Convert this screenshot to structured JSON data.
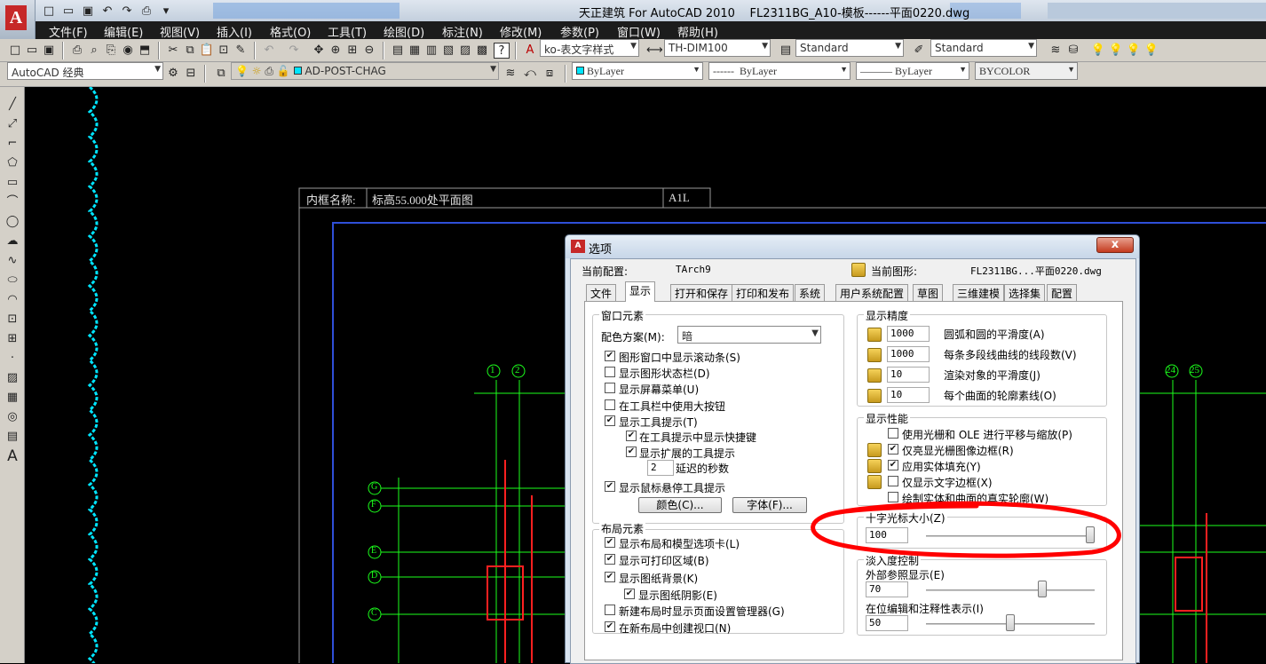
{
  "window": {
    "app_title": "天正建筑 For AutoCAD 2010",
    "file_title": "FL2311BG_A10-模板------平面0220.dwg"
  },
  "menu": [
    "文件(F)",
    "编辑(E)",
    "视图(V)",
    "插入(I)",
    "格式(O)",
    "工具(T)",
    "绘图(D)",
    "标注(N)",
    "修改(M)",
    "参数(P)",
    "窗口(W)",
    "帮助(H)"
  ],
  "toolbar1": {
    "text_style": "ko-表文字样式",
    "dim_style": "TH-DIM100",
    "table_style": "Standard",
    "mleader_style": "Standard"
  },
  "toolbar2": {
    "workspace": "AutoCAD 经典",
    "layer": "AD-POST-CHAG",
    "color": "ByLayer",
    "linetype": "ByLayer",
    "lineweight": "ByLayer",
    "plotstyle": "BYCOLOR"
  },
  "drawing": {
    "frame_label": "内框名称:",
    "frame_name": "标高55.000处平面图",
    "sheet_no": "A1L",
    "axes_top_left": [
      "1",
      "2"
    ],
    "axes_top_right": [
      "24",
      "25"
    ],
    "axes_left": [
      "G",
      "F",
      "E",
      "D",
      "C"
    ]
  },
  "dialog": {
    "title": "选项",
    "close_label": "x",
    "current_profile_label": "当前配置:",
    "current_profile": "TArch9",
    "current_drawing_label": "当前图形:",
    "current_drawing": "FL2311BG...平面0220.dwg",
    "tabs": [
      "文件",
      "显示",
      "打开和保存",
      "打印和发布",
      "系统",
      "用户系统配置",
      "草图",
      "三维建模",
      "选择集",
      "配置"
    ],
    "window_elements": {
      "title": "窗口元素",
      "color_scheme_label": "配色方案(M):",
      "color_scheme": "暗",
      "items": [
        {
          "label": "图形窗口中显示滚动条(S)",
          "checked": true
        },
        {
          "label": "显示图形状态栏(D)",
          "checked": false
        },
        {
          "label": "显示屏幕菜单(U)",
          "checked": false
        },
        {
          "label": "在工具栏中使用大按钮",
          "checked": false
        },
        {
          "label": "显示工具提示(T)",
          "checked": true
        },
        {
          "label": "在工具提示中显示快捷键",
          "checked": true
        },
        {
          "label": "显示扩展的工具提示",
          "checked": true
        }
      ],
      "delay_value": "2",
      "delay_label": "延迟的秒数",
      "hover_tip": {
        "label": "显示鼠标悬停工具提示",
        "checked": true
      },
      "colors_button": "颜色(C)...",
      "fonts_button": "字体(F)..."
    },
    "layout_elements": {
      "title": "布局元素",
      "items": [
        {
          "label": "显示布局和模型选项卡(L)",
          "checked": true
        },
        {
          "label": "显示可打印区域(B)",
          "checked": true
        },
        {
          "label": "显示图纸背景(K)",
          "checked": true
        },
        {
          "label": "显示图纸阴影(E)",
          "checked": true
        },
        {
          "label": "新建布局时显示页面设置管理器(G)",
          "checked": false
        },
        {
          "label": "在新布局中创建视口(N)",
          "checked": true
        }
      ]
    },
    "display_resolution": {
      "title": "显示精度",
      "items": [
        {
          "value": "1000",
          "label": "圆弧和圆的平滑度(A)"
        },
        {
          "value": "1000",
          "label": "每条多段线曲线的线段数(V)"
        },
        {
          "value": "10",
          "label": "渲染对象的平滑度(J)"
        },
        {
          "value": "10",
          "label": "每个曲面的轮廓素线(O)"
        }
      ]
    },
    "display_performance": {
      "title": "显示性能",
      "items": [
        {
          "label": "使用光栅和 OLE 进行平移与缩放(P)",
          "checked": false
        },
        {
          "label": "仅亮显光栅图像边框(R)",
          "checked": true
        },
        {
          "label": "应用实体填充(Y)",
          "checked": true
        },
        {
          "label": "仅显示文字边框(X)",
          "checked": false
        },
        {
          "label": "绘制实体和曲面的真实轮廓(W)",
          "checked": false
        }
      ]
    },
    "crosshair": {
      "title": "十字光标大小(Z)",
      "value": "100",
      "slider": 1.0
    },
    "fade": {
      "title": "淡入度控制",
      "xref_label": "外部参照显示(E)",
      "xref_value": "70",
      "xref_slider": 0.7,
      "inplace_label": "在位编辑和注释性表示(I)",
      "inplace_value": "50",
      "inplace_slider": 0.5
    }
  },
  "colors": {
    "accent_red": "#ff0000",
    "cyan_line": "#00e5ff",
    "green_axis": "#1cff1c"
  }
}
